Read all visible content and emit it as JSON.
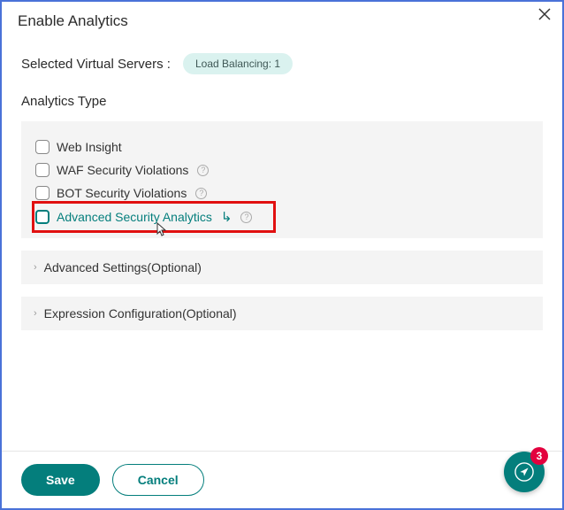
{
  "header": {
    "title": "Enable Analytics"
  },
  "selected": {
    "label": "Selected Virtual Servers :",
    "badge": "Load Balancing: 1"
  },
  "analyticsType": {
    "heading": "Analytics Type",
    "options": [
      {
        "label": "Web Insight",
        "teal": false,
        "help": false
      },
      {
        "label": "WAF Security Violations",
        "teal": false,
        "help": true
      },
      {
        "label": "BOT Security Violations",
        "teal": false,
        "help": true
      },
      {
        "label": "Advanced Security Analytics",
        "teal": true,
        "help": true,
        "arrow": true
      }
    ]
  },
  "expanders": [
    {
      "label": "Advanced Settings(Optional)"
    },
    {
      "label": "Expression Configuration(Optional)"
    }
  ],
  "footer": {
    "save": "Save",
    "cancel": "Cancel"
  },
  "fab": {
    "badge": "3"
  }
}
